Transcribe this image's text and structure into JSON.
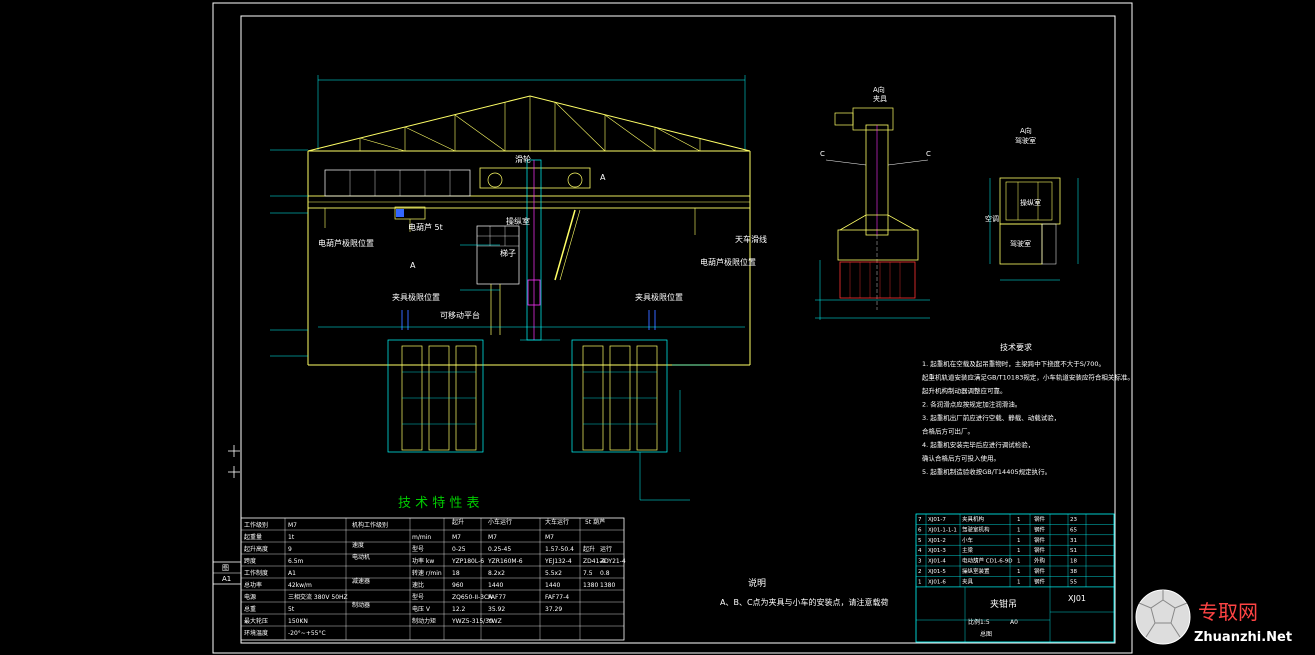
{
  "colors": {
    "background": "#000000",
    "frame": "#ffffff",
    "structure": "#ffff66",
    "dimension": "#00ffff",
    "hidden": "#00cc00",
    "accent_red": "#ff3333",
    "accent_blue": "#3366ff",
    "magenta": "#ff33ff",
    "watermark": "#ff4444"
  },
  "labels": {
    "trolley_label": "滑轮",
    "operator_cab_label": "操纵室",
    "ladder_label": "梯子",
    "trolley_a": "A",
    "electric_hoist_label": "电葫芦 5t",
    "electric_hoist_left": "电葫芦极限位置",
    "electric_hoist_right": "电葫芦极限位置",
    "main_hook_label": "天车滑线",
    "section_a": "A",
    "clamp_limit_left": "夹具极限位置",
    "clamp_limit_right": "夹具极限位置",
    "movable_platform": "可移动平台",
    "side_view_title_line1": "A向",
    "side_view_title_line2": "夹具",
    "side_view_c_left": "C",
    "side_view_c_right": "C",
    "cab_view_title_line1": "A向",
    "cab_view_title_line2": "驾驶室",
    "cab_label_operator": "操纵室",
    "cab_label_air": "空调",
    "cab_label_drive": "驾驶室"
  },
  "tech_requirements": {
    "title": "技术要求",
    "items": [
      "1. 起重机在空载及起吊重物时，主梁跨中下挠度不大于S/700。",
      "   起重机轨道安装应满足GB/T10183规定，小车轨道安装应符合相关标准。",
      "   起升机构制动器调整应可靠。",
      "2. 各润滑点应按规定加注润滑油。",
      "3. 起重机出厂前应进行空载、静载、动载试验，",
      "   合格后方可出厂。",
      "4. 起重机安装完毕后应进行调试检验，",
      "   确认合格后方可投入使用。",
      "5. 起重机制造验收按GB/T14405规定执行。"
    ]
  },
  "spec_table": {
    "title": "技 术 特 性 表",
    "left_rows": [
      [
        "工作级别",
        "M7"
      ],
      [
        "起重量",
        "1t"
      ],
      [
        "起升高度",
        "9"
      ],
      [
        "跨度",
        "6.5m"
      ],
      [
        "工作制度",
        "A1"
      ],
      [
        "总功率",
        "42kw/m"
      ],
      [
        "电源",
        "三相交流 380V 50HZ"
      ],
      [
        "总重",
        "5t"
      ],
      [
        "最大轮压",
        "150KN"
      ],
      [
        "环境温度",
        "-20°~+55°C"
      ]
    ],
    "mid_headers": [
      "机构工作级别",
      "速度",
      "电动机",
      "",
      "减速器",
      "",
      "制动器"
    ],
    "mid_sub": [
      "",
      "m/min",
      "型号",
      "功率 kw",
      "转速 r/min",
      "速比",
      "型号",
      "电压 V",
      "制动力矩"
    ],
    "col_headers": [
      "起升",
      "小车运行",
      "大车运行",
      "5t 葫芦"
    ],
    "col_sub": [
      "",
      "",
      "",
      "起升",
      "运行"
    ],
    "cell_values": [
      [
        "M7",
        "M7",
        "M7",
        "",
        ""
      ],
      [
        "0-25",
        "0.25-45",
        "1.57-50.4",
        "起升",
        "运行"
      ],
      [
        "YZP180L-6",
        "YZR160M-6",
        "YEJ132-4",
        "ZD41-4",
        "ZDY21-4"
      ],
      [
        "18",
        "8.2x2",
        "5.5x2",
        "7.5",
        "0.8"
      ],
      [
        "960",
        "1440",
        "1440",
        "1380",
        "1380"
      ],
      [
        "ZQ650-II-3CA",
        "FAF77",
        "FAF77-4",
        "",
        ""
      ],
      [
        "12.2",
        "35.92",
        "37.29",
        "",
        ""
      ],
      [
        "YWZ5-315/30",
        "YWZ",
        "",
        "",
        ""
      ],
      [
        "",
        "",
        "",
        "",
        ""
      ]
    ]
  },
  "notes": {
    "title": "说明",
    "text": "A、B、C点为夹具与小车的安装点，请注意载荷"
  },
  "title_block": {
    "drawing_name": "夹钳吊",
    "drawing_code": "XJ01",
    "scale_text": "比例1:5",
    "sheet_text": "A0",
    "bottom_text": "总图",
    "bom_rows": [
      [
        "XJ01-7",
        "夹具机构",
        "1",
        "钢件",
        "23"
      ],
      [
        "XJ01-1-1-1",
        "驾驶室机构",
        "1",
        "钢件",
        "65"
      ],
      [
        "XJ01-2",
        "小车",
        "1",
        "钢件",
        "31"
      ],
      [
        "XJ01-3",
        "主梁",
        "1",
        "钢件",
        "S1"
      ],
      [
        "XJ01-4",
        "电动葫芦 CD1-6-9D",
        "1",
        "外购",
        "18"
      ],
      [
        "XJ01-5",
        "操纵室装置",
        "1",
        "钢件",
        "38"
      ],
      [
        "XJ01-6",
        "夹具",
        "1",
        "钢件",
        "55"
      ]
    ]
  },
  "side_stamp": {
    "top": "图",
    "bottom": "A1"
  },
  "watermark": {
    "chinese": "专取网",
    "latin": "Zhuanzhi.Net"
  }
}
